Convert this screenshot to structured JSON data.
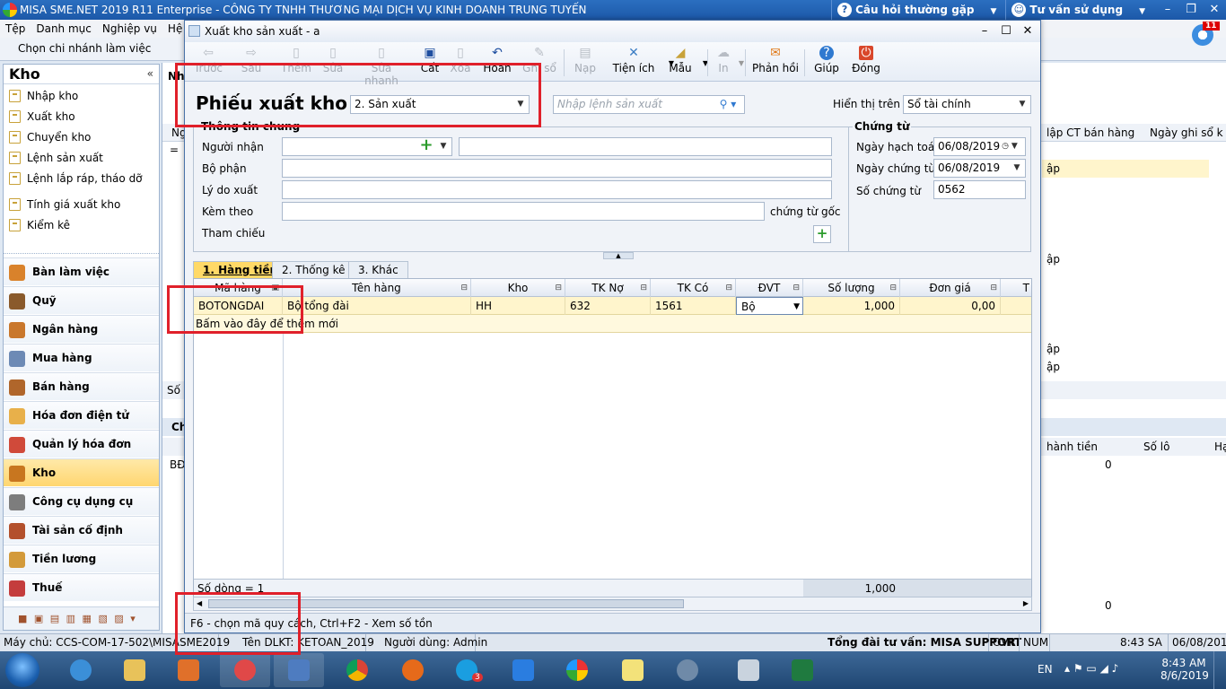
{
  "app": {
    "title": "MISA SME.NET 2019 R11 Enterprise - CÔNG TY TNHH THƯƠNG MẠI DỊCH VỤ KINH DOANH TRUNG TUYẾN",
    "help_faq": "Câu hỏi thường gặp",
    "help_consult": "Tư vấn sử dụng",
    "notif_count": "11",
    "branch_label": "Chọn chi nhánh làm việc"
  },
  "menu": [
    "Tệp",
    "Danh mục",
    "Nghiệp vụ",
    "Hệ thố"
  ],
  "sidebar": {
    "title": "Kho",
    "items": [
      "Nhập kho",
      "Xuất kho",
      "Chuyển kho",
      "Lệnh sản xuất",
      "Lệnh lắp ráp, tháo dỡ"
    ],
    "items2": [
      "Tính giá xuất kho",
      "Kiểm kê"
    ],
    "modules": [
      "Bàn làm việc",
      "Quỹ",
      "Ngân hàng",
      "Mua hàng",
      "Bán hàng",
      "Hóa đơn điện tử",
      "Quản lý hóa đơn",
      "Kho",
      "Công cụ dụng cụ",
      "Tài sản cố định",
      "Tiền lương",
      "Thuế"
    ]
  },
  "background": {
    "tab_short": "Nhậ",
    "col1": "Ng",
    "col2": "lập CT bán hàng",
    "col3": "Ngày ghi sổ k",
    "label_so": "Số c",
    "label_ch": "Ch",
    "row_bd": "BĐ",
    "col4": "hành tiền",
    "col5": "Số lô",
    "col6": "Hạ",
    "zero1": "0",
    "zero2": "0",
    "row_text": "ập",
    "row_text2": "ập",
    "row_text3": "ập",
    "row_text4": "ập",
    "eq": "="
  },
  "dialog": {
    "title": "Xuất kho sản xuất - a",
    "toolbar": {
      "prev": "Trước",
      "next": "Sau",
      "add": "Thêm",
      "edit": "Sửa",
      "quick_edit": "Sửa nhanh",
      "save": "Cất",
      "delete": "Xóa",
      "undo": "Hoãn",
      "post": "Ghi sổ",
      "load": "Nạp",
      "utility": "Tiện ích",
      "template": "Mẫu",
      "print": "In",
      "feedback": "Phản hồi",
      "help": "Giúp",
      "close": "Đóng"
    },
    "form_title": "Phiếu xuất kho",
    "type_value": "2. Sản xuất",
    "production_order_placeholder": "Nhập lệnh sản xuất",
    "display_label": "Hiển thị trên sổ",
    "display_value": "Sổ tài chính",
    "general": {
      "title": "Thông tin chung",
      "receiver": "Người nhận",
      "department": "Bộ phận",
      "reason": "Lý do xuất",
      "attach": "Kèm theo",
      "attach_suffix": "chứng từ gốc",
      "reference": "Tham chiếu"
    },
    "voucher": {
      "title": "Chứng từ",
      "posting_date_label": "Ngày hạch toán",
      "posting_date": "06/08/2019",
      "voucher_date_label": "Ngày chứng từ",
      "voucher_date": "06/08/2019",
      "voucher_no_label": "Số chứng từ",
      "voucher_no": "0562"
    },
    "tabs": [
      "1. Hàng tiền",
      "2. Thống kê",
      "3. Khác"
    ],
    "grid": {
      "columns": [
        "Mã hàng",
        "Tên hàng",
        "Kho",
        "TK Nợ",
        "TK Có",
        "ĐVT",
        "Số lượng",
        "Đơn giá",
        "T"
      ],
      "rows": [
        {
          "code": "BOTONGDAI",
          "name": "Bộ tổng đài",
          "warehouse": "HH",
          "debit": "632",
          "credit": "1561",
          "unit": "Bộ",
          "qty": "1,000",
          "price": "0,00"
        }
      ],
      "add_new": "Bấm vào đây để thêm mới",
      "row_count": "Số dòng = 1",
      "total_qty": "1,000"
    },
    "hint": "F6 - chọn mã quy cách, Ctrl+F2 - Xem số tồn"
  },
  "statusbar": {
    "server": "Máy chủ: CCS-COM-17-502\\MISASME2019",
    "dbname": "Tên DLKT: KETOAN_2019",
    "user": "Người dùng: Admin",
    "hotline": "Tổng đài tư vấn: MISA SUPPORT",
    "ovr": "OVR",
    "num": "NUM",
    "time": "8:43 SA",
    "date": "06/08/2019"
  },
  "taskbar": {
    "lang": "EN",
    "clock_time": "8:43 AM",
    "clock_date": "8/6/2019",
    "skype_badge": "3"
  }
}
